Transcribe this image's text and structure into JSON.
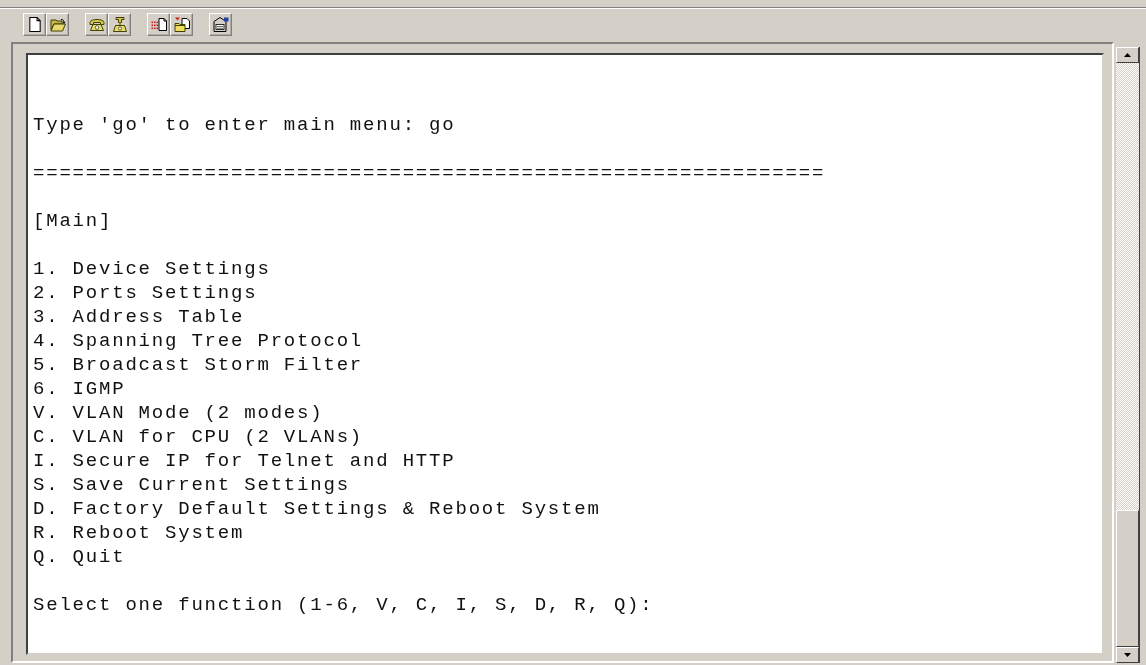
{
  "terminal": {
    "prompt": "Type 'go' to enter main menu: go",
    "separator": "============================================================",
    "menu_title": "[Main]",
    "menu_items": [
      "1. Device Settings",
      "2. Ports Settings",
      "3. Address Table",
      "4. Spanning Tree Protocol",
      "5. Broadcast Storm Filter",
      "6. IGMP",
      "V. VLAN Mode (2 modes)",
      "C. VLAN for CPU (2 VLANs)",
      "I. Secure IP for Telnet and HTTP",
      "S. Save Current Settings",
      "D. Factory Default Settings & Reboot System",
      "R. Reboot System",
      "Q. Quit"
    ],
    "select_prompt": "Select one function (1-6, V, C, I, S, D, R, Q):"
  }
}
